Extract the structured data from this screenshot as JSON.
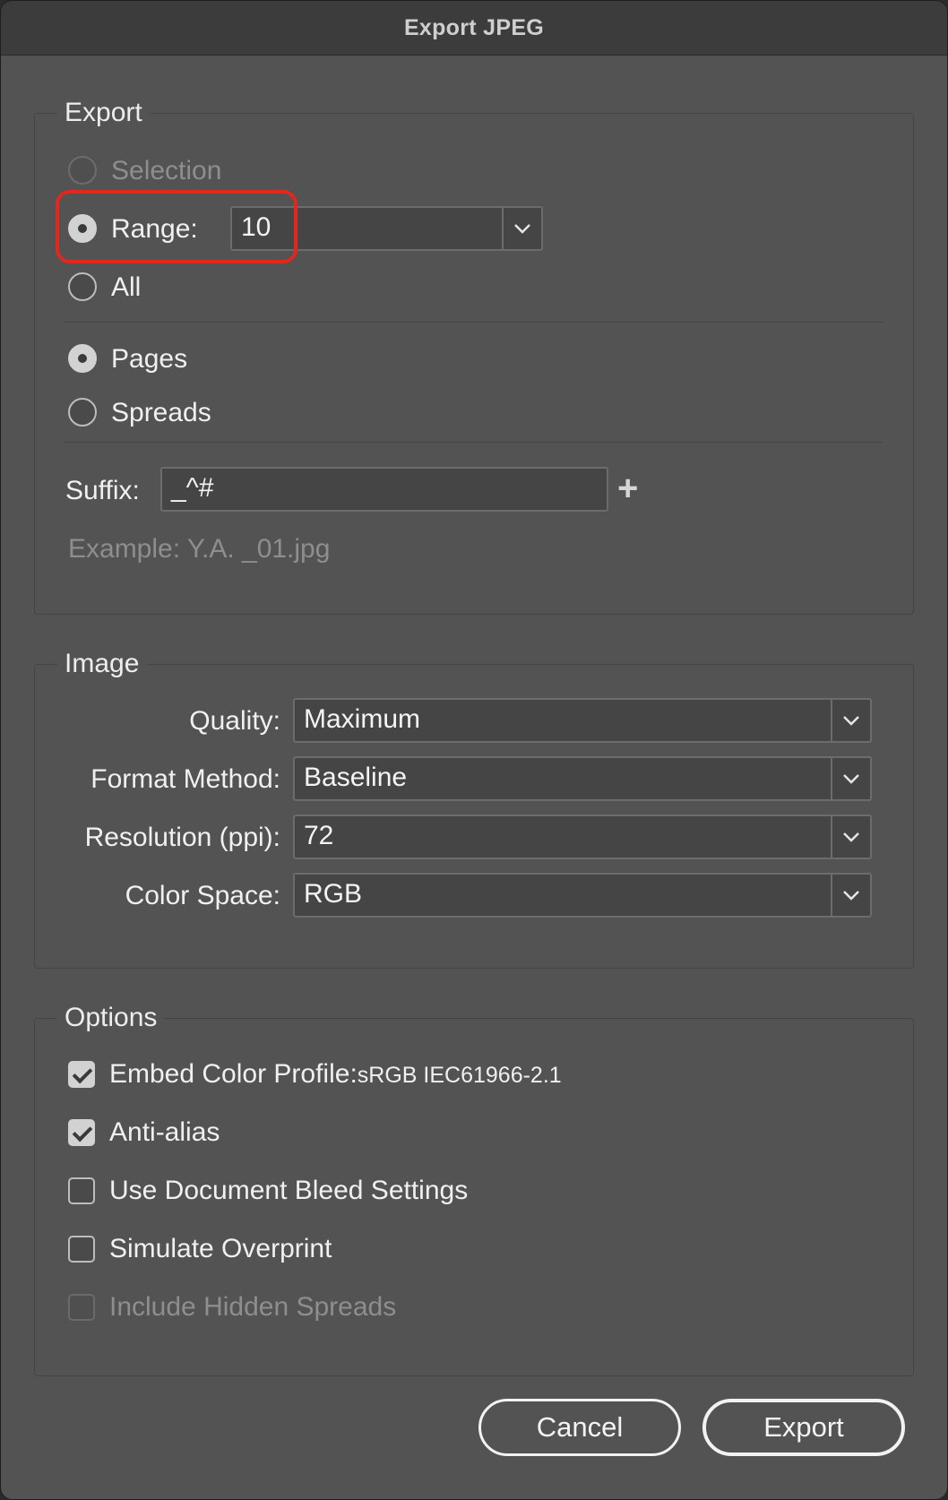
{
  "window": {
    "title": "Export JPEG"
  },
  "export": {
    "title": "Export",
    "selection_label": "Selection",
    "range_label": "Range:",
    "range_value": "10",
    "all_label": "All",
    "pages_label": "Pages",
    "spreads_label": "Spreads",
    "suffix_label": "Suffix:",
    "suffix_value": "_^#",
    "example_text": "Example: Y.A. _01.jpg"
  },
  "image": {
    "title": "Image",
    "quality_label": "Quality:",
    "quality_value": "Maximum",
    "format_label": "Format Method:",
    "format_value": "Baseline",
    "resolution_label": "Resolution (ppi):",
    "resolution_value": "72",
    "colorspace_label": "Color Space:",
    "colorspace_value": "RGB"
  },
  "options": {
    "title": "Options",
    "embed_label": "Embed Color Profile:",
    "embed_profile": "sRGB IEC61966-2.1",
    "antialias_label": "Anti-alias",
    "bleed_label": "Use Document Bleed Settings",
    "overprint_label": "Simulate Overprint",
    "hidden_label": "Include Hidden Spreads"
  },
  "buttons": {
    "cancel": "Cancel",
    "export": "Export"
  },
  "state": {
    "selected_range_option": "Range",
    "selected_layout_option": "Pages",
    "embed_checked": true,
    "antialias_checked": true,
    "bleed_checked": false,
    "overprint_checked": false,
    "hidden_checked": false
  },
  "colors": {
    "highlight": "#e0281e",
    "panel": "#535353",
    "titlebar": "#3c3c3c"
  },
  "icons": {
    "dropdown": "chevron-down-icon",
    "add": "plus-icon",
    "check": "checkmark-icon"
  }
}
